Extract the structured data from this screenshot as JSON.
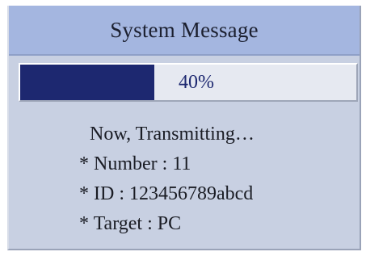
{
  "dialog": {
    "title": "System Message",
    "progress": {
      "fraction": 0.4,
      "label": "40%"
    },
    "status": "Now, Transmitting…",
    "details": [
      "* Number : 11",
      "* ID : 123456789abcd",
      "* Target : PC"
    ],
    "colors": {
      "title_bar": "#a4b6e0",
      "body": "#c8d0e2",
      "progress_fill": "#1d2870",
      "progress_track": "#e6e9f1"
    }
  }
}
